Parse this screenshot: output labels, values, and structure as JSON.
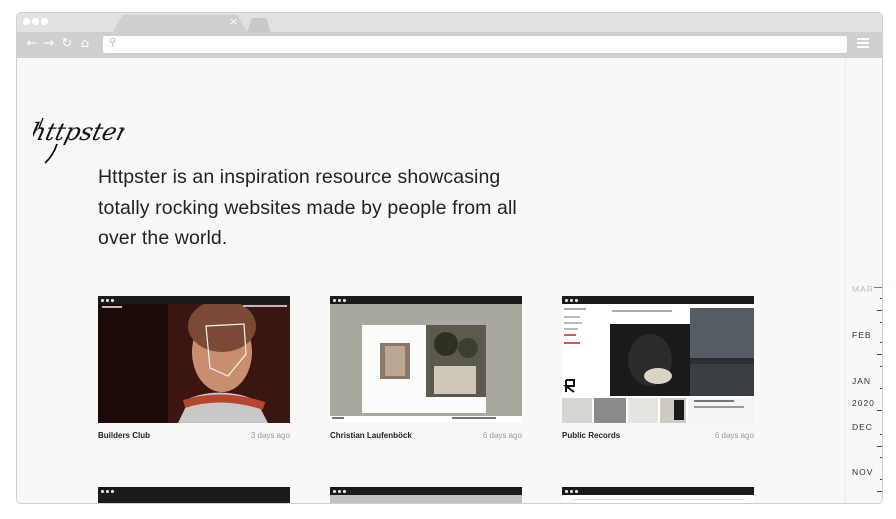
{
  "browser": {
    "tab_close": "×",
    "back": "←",
    "forward": "→",
    "reload": "↻",
    "home": "⌂",
    "url_icon": "search-icon",
    "url_value": ""
  },
  "site": {
    "logo": "httpster",
    "intro": "Httpster is an inspiration resource showcasing totally rocking websites made by people from all over the world."
  },
  "cards": [
    {
      "name": "Builders Club",
      "time": "3 days ago"
    },
    {
      "name": "Christian Laufenböck",
      "time": "6 days ago"
    },
    {
      "name": "Public Records",
      "time": "6 days ago"
    }
  ],
  "timeline": {
    "months": [
      "MAR",
      "FEB",
      "JAN",
      "2020",
      "DEC",
      "NOV"
    ],
    "accent": "#e9533a"
  }
}
